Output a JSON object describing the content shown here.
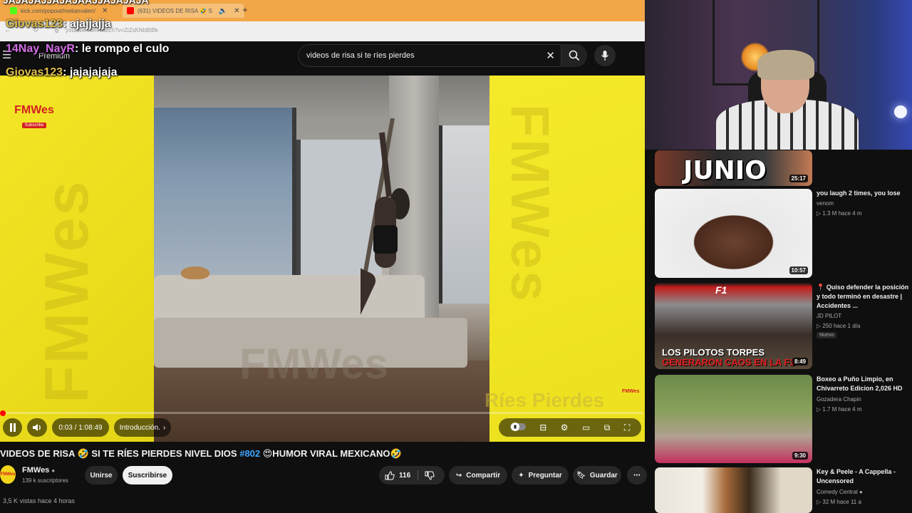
{
  "browser": {
    "tabs": [
      {
        "label": "kick.com/popout/melianvalen/",
        "active": false
      },
      {
        "label": "(631) VIDEOS DE RISA 🤣 S",
        "active": true
      }
    ],
    "address": "youtube.com/watch?v=ZiZxKNbBtBk"
  },
  "youtube": {
    "premium_label": "Premium",
    "search_value": "videos de risa si te ríes pierdes"
  },
  "player": {
    "time": "0:03 / 1:08:49",
    "chapter": "Introducción.",
    "progress": 0.002,
    "watermark": "FMWes",
    "channel_logo": "FMWes",
    "subscribe_badge": "Subscribe",
    "overlay_text": "Ríes Pierdes"
  },
  "chat": [
    {
      "user": "",
      "message": "JAJAJAJJAJAJAAJJAJAJAJA",
      "color": "#ffffff"
    },
    {
      "user": "Giovas123",
      "message": ": ajajjajja",
      "color": "#e0c04a"
    },
    {
      "user": "14Nay_NayR",
      "message": ": le rompo el culo",
      "color": "#d46ee8"
    },
    {
      "user": "Giovas123",
      "message": ": jajajajaja",
      "color": "#e0c04a"
    }
  ],
  "video": {
    "title_part1": "VIDEOS DE RISA 🤣 SI TE RÍES PIERDES NIVEL DIOS ",
    "title_tag": "#802",
    "title_part2": " 😍HUMOR VIRAL MEXICANO🤣",
    "channel": "FMWes",
    "subscribers": "139 k suscriptores",
    "join_label": "Unirse",
    "subscribe_label": "Suscribirse",
    "likes": "116",
    "share_label": "Compartir",
    "ask_label": "Preguntar",
    "save_label": "Guardar",
    "views": "3,5 K vistas  hace 4 horas"
  },
  "recommendations": [
    {
      "thumb_text": "JUNIO",
      "duration": "25:17",
      "title": "",
      "channel": "",
      "meta": "",
      "badge": ""
    },
    {
      "thumb_text": "",
      "duration": "10:57",
      "title": "you laugh 2 times, you lose",
      "channel": "venom",
      "meta": "▷ 1.3 M   hace 4 m",
      "badge": ""
    },
    {
      "thumb_text": "LOS PILOTOS TORPES",
      "thumb_text2": "GENERARON CAOS EN LA F1",
      "duration": "8:49",
      "title": "📍 Quiso defender la posición y todo terminó en desastre | Accidentes ...",
      "channel": "JD PILOT",
      "meta": "▷ 250   hace 1 día",
      "badge": "Nuevo"
    },
    {
      "thumb_text": "",
      "duration": "9:30",
      "title": "Boxeo a Puño Limpio, en Chivarreto Edicion 2,026 HD",
      "channel": "Gozadera Chapin",
      "meta": "▷ 1.7 M   hace 4 m",
      "badge": ""
    },
    {
      "thumb_text": "",
      "duration": "",
      "title": "Key & Peele - A Cappella - Uncensored",
      "channel": "Comedy Central",
      "meta": "▷ 32 M   hace 11 a",
      "badge": ""
    }
  ],
  "colors": {
    "accent": "#ff0000",
    "link": "#3ea6ff",
    "bg": "#0f0f0f",
    "tab_bar": "#f3a646"
  }
}
